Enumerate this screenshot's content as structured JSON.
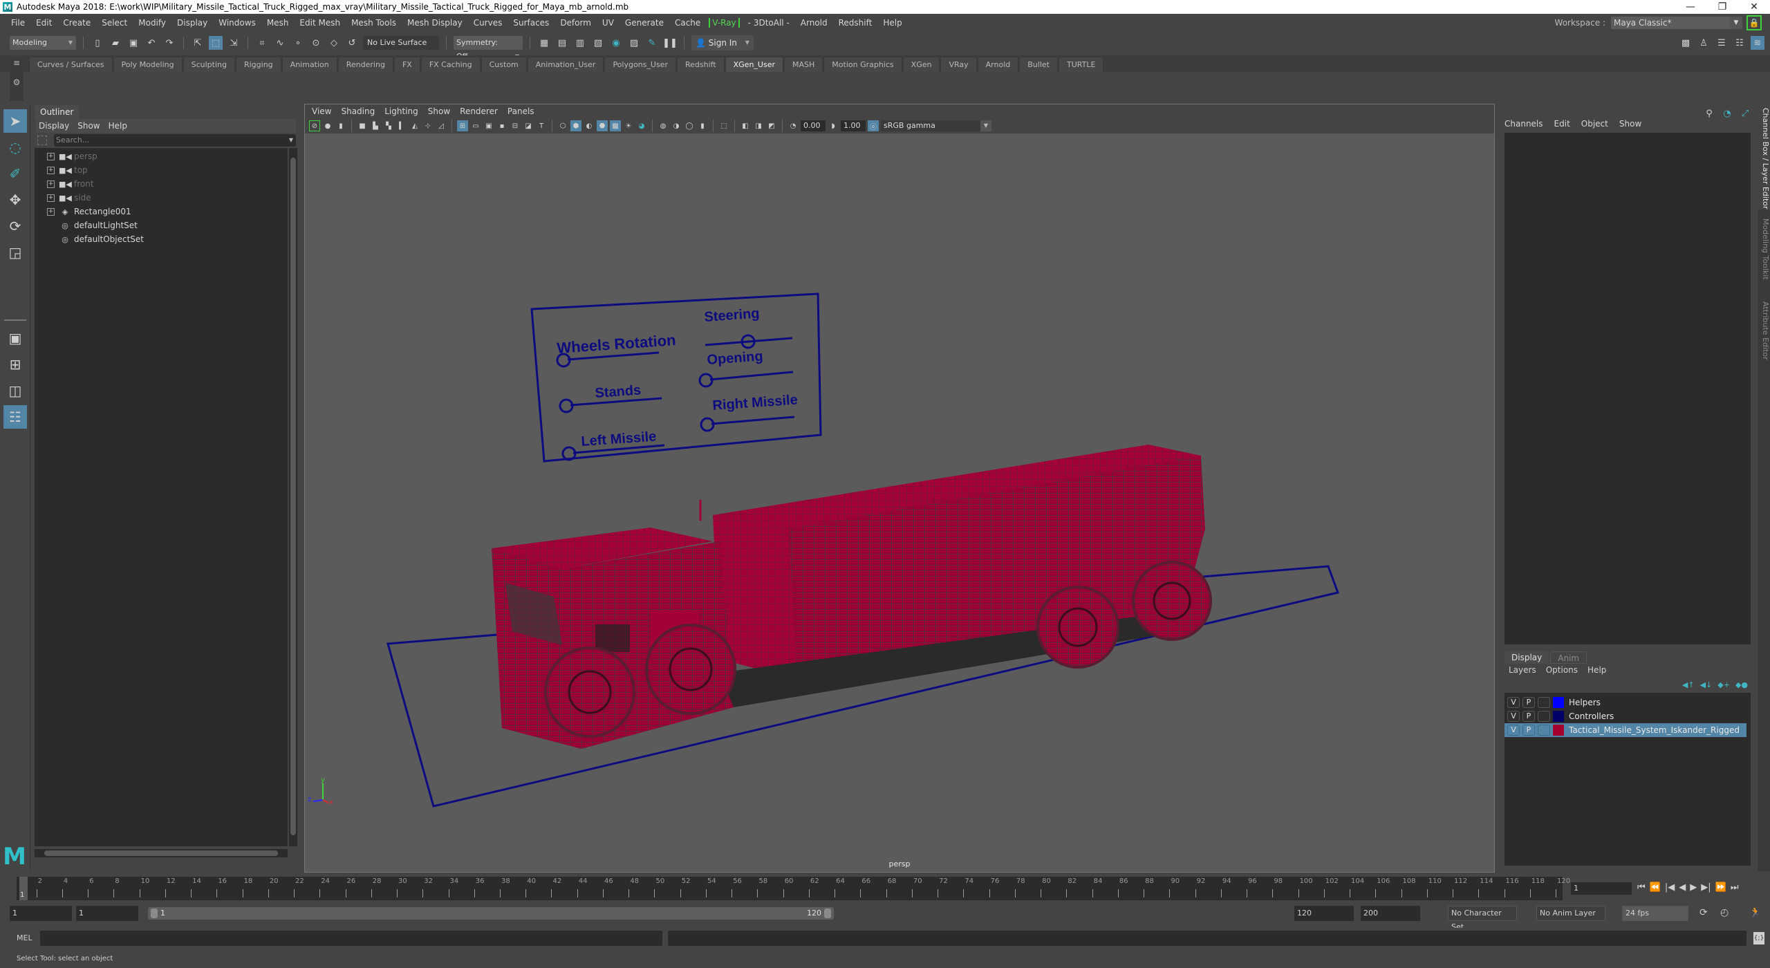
{
  "window": {
    "title": "Autodesk Maya 2018: E:\\work\\WIP\\Military_Missile_Tactical_Truck_Rigged_max_vray\\Military_Missile_Tactical_Truck_Rigged_for_Maya_mb_arnold.mb",
    "minimize": "—",
    "restore": "❐",
    "close": "✕"
  },
  "menubar": {
    "items": [
      "File",
      "Edit",
      "Create",
      "Select",
      "Modify",
      "Display",
      "Windows",
      "Mesh",
      "Edit Mesh",
      "Mesh Tools",
      "Mesh Display",
      "Curves",
      "Surfaces",
      "Deform",
      "UV",
      "Generate",
      "Cache"
    ],
    "vray": "V-Ray",
    "extra": [
      "- 3DtoAll -",
      "Arnold",
      "Redshift",
      "Help"
    ],
    "workspace_label": "Workspace :",
    "workspace_value": "Maya Classic*"
  },
  "statusline": {
    "mode": "Modeling",
    "live_surface": "No Live Surface",
    "symmetry": "Symmetry: Off",
    "sign_in": "Sign In"
  },
  "shelf": {
    "tabs": [
      "Curves / Surfaces",
      "Poly Modeling",
      "Sculpting",
      "Rigging",
      "Animation",
      "Rendering",
      "FX",
      "FX Caching",
      "Custom",
      "Animation_User",
      "Polygons_User",
      "Redshift",
      "XGen_User",
      "MASH",
      "Motion Graphics",
      "XGen",
      "VRay",
      "Arnold",
      "Bullet",
      "TURTLE"
    ],
    "active_tab": "XGen_User"
  },
  "outliner": {
    "title": "Outliner",
    "menus": [
      "Display",
      "Show",
      "Help"
    ],
    "search_placeholder": "Search...",
    "items": [
      {
        "label": "persp",
        "type": "camera",
        "expandable": true,
        "dim": true
      },
      {
        "label": "top",
        "type": "camera",
        "expandable": true,
        "dim": true
      },
      {
        "label": "front",
        "type": "camera",
        "expandable": true,
        "dim": true
      },
      {
        "label": "side",
        "type": "camera",
        "expandable": true,
        "dim": true
      },
      {
        "label": "Rectangle001",
        "type": "transform",
        "expandable": true,
        "dim": false
      },
      {
        "label": "defaultLightSet",
        "type": "set",
        "expandable": false,
        "dim": false
      },
      {
        "label": "defaultObjectSet",
        "type": "set",
        "expandable": false,
        "dim": false
      }
    ]
  },
  "viewport": {
    "menus": [
      "View",
      "Shading",
      "Lighting",
      "Show",
      "Renderer",
      "Panels"
    ],
    "exposure": "0.00",
    "gamma": "1.00",
    "color_space": "sRGB gamma",
    "camera": "persp",
    "axis": {
      "x": "x",
      "y": "y",
      "z": "z"
    },
    "control_panel": {
      "labels": [
        "Wheels Rotation",
        "Steering",
        "Stands",
        "Opening",
        "Left Missile",
        "Right Missile"
      ]
    },
    "colors": {
      "mesh": "#a3003a",
      "controllers": "#0a0a7a",
      "background": "#5b5b5b"
    }
  },
  "channelbox": {
    "menus": [
      "Channels",
      "Edit",
      "Object",
      "Show"
    ]
  },
  "layers": {
    "tabs": [
      "Display",
      "Anim"
    ],
    "menus": [
      "Layers",
      "Options",
      "Help"
    ],
    "rows": [
      {
        "v": "V",
        "p": "P",
        "color": "#0000ff",
        "name": "Helpers",
        "selected": false
      },
      {
        "v": "V",
        "p": "P",
        "color": "#000066",
        "name": "Controllers",
        "selected": false
      },
      {
        "v": "V",
        "p": "P",
        "color": "#a3002e",
        "name": "Tactical_Missile_System_Iskander_Rigged",
        "selected": true
      }
    ]
  },
  "side_tabs": [
    "Channel Box / Layer Editor",
    "Modeling Toolkit",
    "Attribute Editor"
  ],
  "timeline": {
    "start": 1,
    "end": 120,
    "current_frame": "1",
    "current_marker": "1"
  },
  "range": {
    "start_time": "1",
    "playback_start": "1",
    "slider_start": "1",
    "slider_end": "120",
    "playback_end": "120",
    "end_time": "200",
    "character_set": "No Character Set",
    "anim_layer": "No Anim Layer",
    "fps": "24 fps"
  },
  "mel": {
    "label": "MEL"
  },
  "helpline": {
    "text": "Select Tool: select an object"
  }
}
